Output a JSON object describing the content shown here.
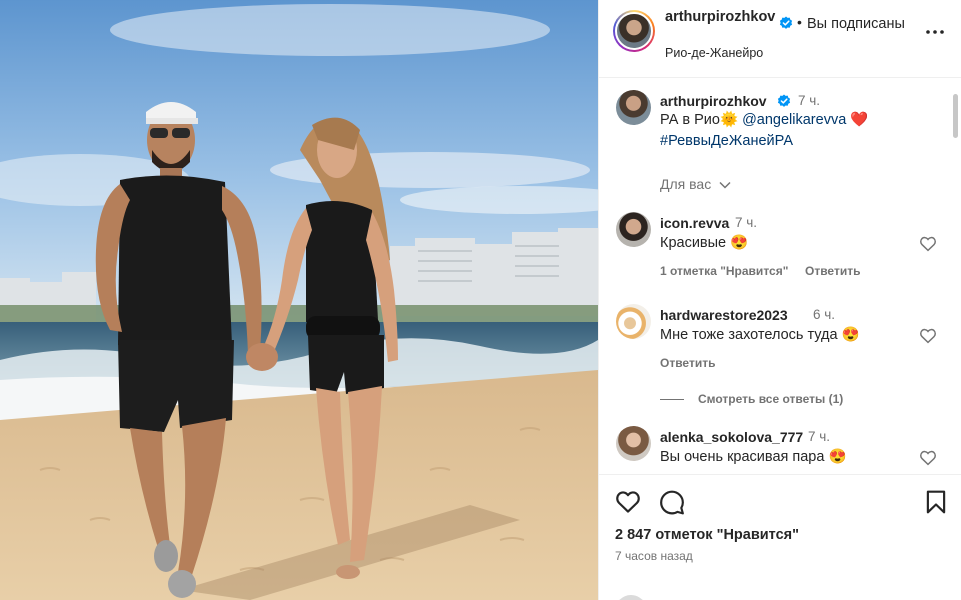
{
  "post": {
    "author": "arthurpirozhkov",
    "verified_icon": "verified-badge-icon",
    "separator": "•",
    "follow_status": "Вы подписаны",
    "location": "Рио-де-Жанейро",
    "more_icon": "more-options-icon"
  },
  "caption": {
    "user": "arthurpirozhkov",
    "time": "7 ч.",
    "text_prefix": "РА в Рио",
    "sun_emoji": "🌞",
    "mention": "@angelikarevva",
    "heart_emoji": "❤️",
    "hashtag": "#РеввыДеЖанейРА"
  },
  "collapse_label": "Для вас",
  "comments": [
    {
      "user": "icon.revva",
      "time": "7 ч.",
      "text": "Красивые 😍",
      "likes_label": "1 отметка \"Нравится\"",
      "reply_label": "Ответить"
    },
    {
      "user": "hardwarestore2023",
      "time": "6 ч.",
      "text": "Мне тоже захотелось туда 😍",
      "reply_label": "Ответить",
      "view_replies_label": "Смотреть все ответы (1)"
    },
    {
      "user": "alenka_sokolova_777",
      "time": "7 ч.",
      "text": "Вы очень красивая пара 😍"
    }
  ],
  "actions": {
    "like_icon": "heart-outline-icon",
    "comment_icon": "comment-bubble-icon",
    "save_icon": "bookmark-icon",
    "likes_count": "2 847 отметок \"Нравится\"",
    "posted_time": "7 часов назад"
  },
  "colors": {
    "verified": "#0095f6",
    "link": "#00376b",
    "secondary_text": "#737373",
    "heart_emoji": "#ed4956"
  }
}
